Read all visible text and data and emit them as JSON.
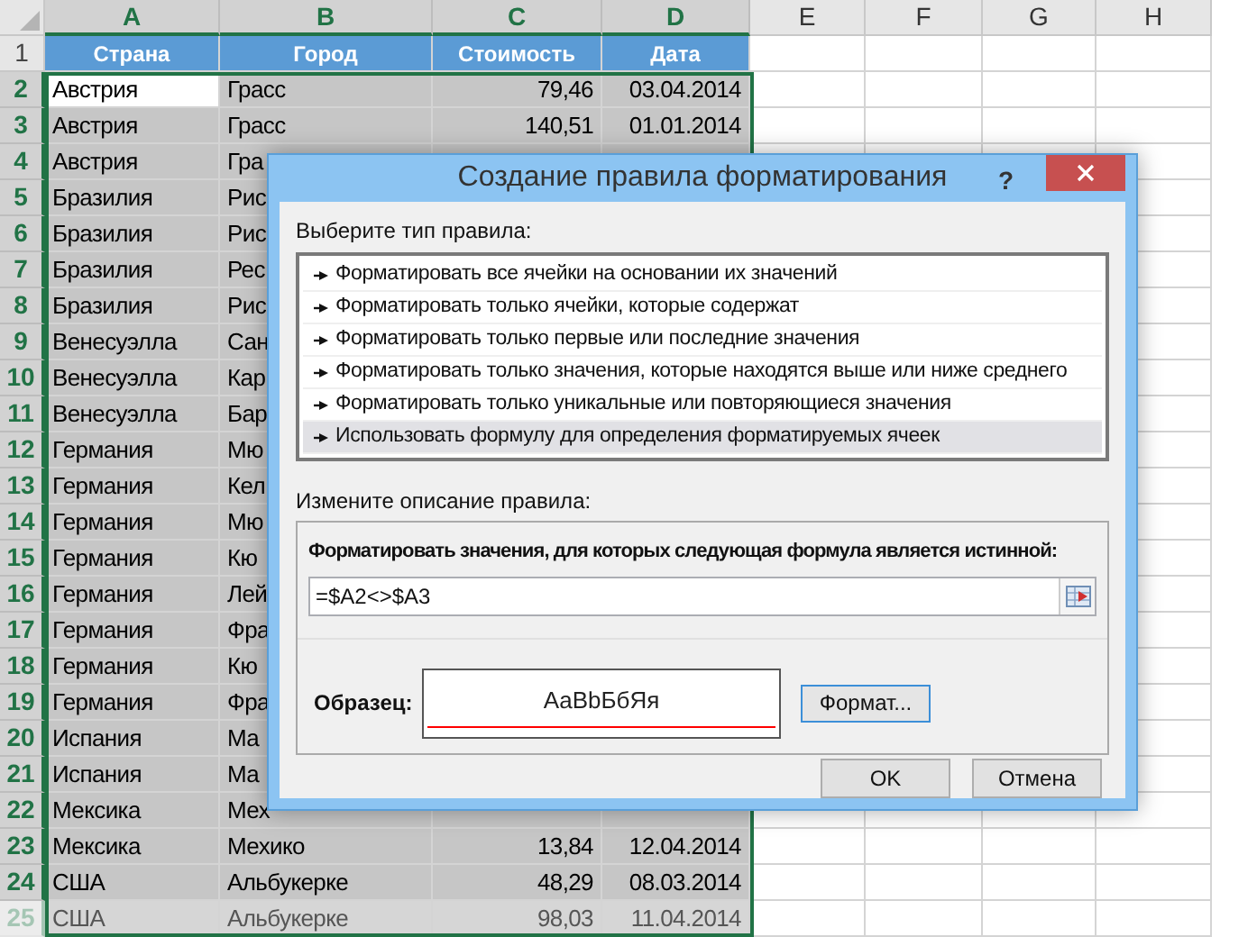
{
  "sheet": {
    "columns": [
      {
        "label": "A",
        "selected": true
      },
      {
        "label": "B",
        "selected": true
      },
      {
        "label": "C",
        "selected": true
      },
      {
        "label": "D",
        "selected": true
      },
      {
        "label": "E",
        "selected": false
      },
      {
        "label": "F",
        "selected": false
      },
      {
        "label": "G",
        "selected": false
      },
      {
        "label": "H",
        "selected": false
      }
    ],
    "header_row": {
      "number": "1",
      "selected": false,
      "cells": [
        "Страна",
        "Город",
        "Стоимость",
        "Дата"
      ]
    },
    "rows": [
      {
        "number": "2",
        "selected": true,
        "active": true,
        "faded": false,
        "cells": [
          "Австрия",
          "Грасс",
          "79,46",
          "03.04.2014"
        ]
      },
      {
        "number": "3",
        "selected": true,
        "active": false,
        "faded": false,
        "cells": [
          "Австрия",
          "Грасс",
          "140,51",
          "01.01.2014"
        ]
      },
      {
        "number": "4",
        "selected": true,
        "active": false,
        "faded": false,
        "cells": [
          "Австрия",
          "Гра"
        ]
      },
      {
        "number": "5",
        "selected": true,
        "active": false,
        "faded": false,
        "cells": [
          "Бразилия",
          "Рис"
        ]
      },
      {
        "number": "6",
        "selected": true,
        "active": false,
        "faded": false,
        "cells": [
          "Бразилия",
          "Рис"
        ]
      },
      {
        "number": "7",
        "selected": true,
        "active": false,
        "faded": false,
        "cells": [
          "Бразилия",
          "Рес"
        ]
      },
      {
        "number": "8",
        "selected": true,
        "active": false,
        "faded": false,
        "cells": [
          "Бразилия",
          "Рис"
        ]
      },
      {
        "number": "9",
        "selected": true,
        "active": false,
        "faded": false,
        "cells": [
          "Венесуэлла",
          "Сан"
        ]
      },
      {
        "number": "10",
        "selected": true,
        "active": false,
        "faded": false,
        "cells": [
          "Венесуэлла",
          "Кар"
        ]
      },
      {
        "number": "11",
        "selected": true,
        "active": false,
        "faded": false,
        "cells": [
          "Венесуэлла",
          "Бар"
        ]
      },
      {
        "number": "12",
        "selected": true,
        "active": false,
        "faded": false,
        "cells": [
          "Германия",
          "Мю"
        ]
      },
      {
        "number": "13",
        "selected": true,
        "active": false,
        "faded": false,
        "cells": [
          "Германия",
          "Кел"
        ]
      },
      {
        "number": "14",
        "selected": true,
        "active": false,
        "faded": false,
        "cells": [
          "Германия",
          "Мю"
        ]
      },
      {
        "number": "15",
        "selected": true,
        "active": false,
        "faded": false,
        "cells": [
          "Германия",
          "Кю"
        ]
      },
      {
        "number": "16",
        "selected": true,
        "active": false,
        "faded": false,
        "cells": [
          "Германия",
          "Лей"
        ]
      },
      {
        "number": "17",
        "selected": true,
        "active": false,
        "faded": false,
        "cells": [
          "Германия",
          "Фра"
        ]
      },
      {
        "number": "18",
        "selected": true,
        "active": false,
        "faded": false,
        "cells": [
          "Германия",
          "Кю"
        ]
      },
      {
        "number": "19",
        "selected": true,
        "active": false,
        "faded": false,
        "cells": [
          "Германия",
          "Фра"
        ]
      },
      {
        "number": "20",
        "selected": true,
        "active": false,
        "faded": false,
        "cells": [
          "Испания",
          "Ма"
        ]
      },
      {
        "number": "21",
        "selected": true,
        "active": false,
        "faded": false,
        "cells": [
          "Испания",
          "Ма"
        ]
      },
      {
        "number": "22",
        "selected": true,
        "active": false,
        "faded": false,
        "cells": [
          "Мексика",
          "Мех"
        ]
      },
      {
        "number": "23",
        "selected": true,
        "active": false,
        "faded": false,
        "cells": [
          "Мексика",
          "Мехико",
          "13,84",
          "12.04.2014"
        ]
      },
      {
        "number": "24",
        "selected": true,
        "active": false,
        "faded": false,
        "cells": [
          "США",
          "Альбукерке",
          "48,29",
          "08.03.2014"
        ]
      },
      {
        "number": "25",
        "selected": true,
        "active": false,
        "faded": true,
        "cells": [
          "США",
          "Альбукерке",
          "98,03",
          "11.04.2014"
        ]
      }
    ]
  },
  "dialog": {
    "title": "Создание правила форматирования",
    "help": "?",
    "rule_type_label": "Выберите тип правила:",
    "rule_types": [
      {
        "label": "Форматировать все ячейки на основании их значений",
        "selected": false
      },
      {
        "label": "Форматировать только ячейки, которые содержат",
        "selected": false
      },
      {
        "label": "Форматировать только первые или последние значения",
        "selected": false
      },
      {
        "label": "Форматировать только значения, которые находятся выше или ниже среднего",
        "selected": false
      },
      {
        "label": "Форматировать только уникальные или повторяющиеся значения",
        "selected": false
      },
      {
        "label": "Использовать формулу для определения форматируемых ячеек",
        "selected": true
      }
    ],
    "description_label": "Измените описание правила:",
    "formula_label": "Форматировать значения, для которых следующая формула является истинной:",
    "formula": "=$A2<>$A3",
    "preview_label": "Образец:",
    "preview_sample": "АаBbБбЯя",
    "format_button": "Формат...",
    "buttons": [
      "OK",
      "Отмена"
    ]
  }
}
